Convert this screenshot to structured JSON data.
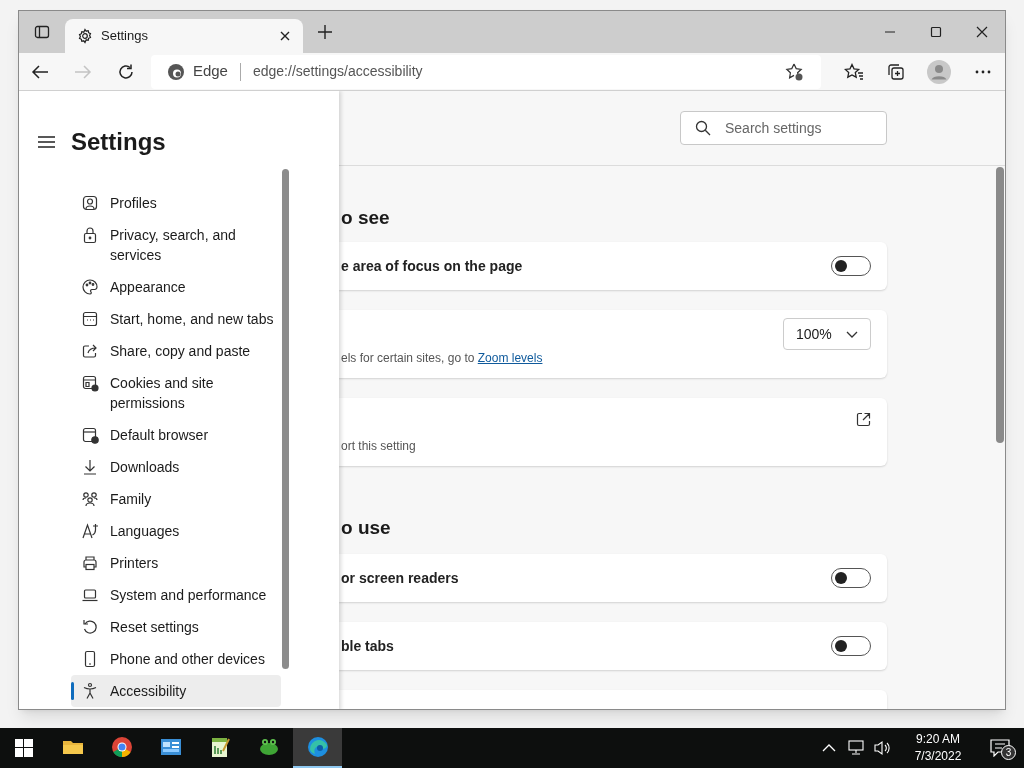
{
  "tab": {
    "title": "Settings"
  },
  "address_bar": {
    "site": "Edge",
    "url": "edge://settings/accessibility"
  },
  "sidebar": {
    "title": "Settings",
    "items": [
      {
        "label": "Profiles",
        "selected": false
      },
      {
        "label": "Privacy, search, and services",
        "selected": false
      },
      {
        "label": "Appearance",
        "selected": false
      },
      {
        "label": "Start, home, and new tabs",
        "selected": false
      },
      {
        "label": "Share, copy and paste",
        "selected": false
      },
      {
        "label": "Cookies and site permissions",
        "selected": false
      },
      {
        "label": "Default browser",
        "selected": false
      },
      {
        "label": "Downloads",
        "selected": false
      },
      {
        "label": "Family",
        "selected": false
      },
      {
        "label": "Languages",
        "selected": false
      },
      {
        "label": "Printers",
        "selected": false
      },
      {
        "label": "System and performance",
        "selected": false
      },
      {
        "label": "Reset settings",
        "selected": false
      },
      {
        "label": "Phone and other devices",
        "selected": false
      },
      {
        "label": "Accessibility",
        "selected": true
      }
    ]
  },
  "search": {
    "placeholder": "Search settings"
  },
  "sections": [
    {
      "heading": "o see",
      "cards": [
        {
          "kind": "toggle",
          "label": "e area of focus on the page",
          "on": false
        },
        {
          "kind": "dropdown",
          "description": "els for certain sites, go to ",
          "link": "Zoom levels",
          "value": "100%"
        },
        {
          "kind": "external",
          "description": "ort this setting"
        }
      ]
    },
    {
      "heading": "o use",
      "cards": [
        {
          "kind": "toggle",
          "label": "or screen readers",
          "on": false
        },
        {
          "kind": "toggle",
          "label": "ble tabs",
          "on": false
        },
        {
          "kind": "blank"
        }
      ]
    }
  ],
  "taskbar": {
    "apps": [
      {
        "selected": false
      },
      {
        "selected": false
      },
      {
        "selected": false
      },
      {
        "selected": false
      },
      {
        "selected": false
      },
      {
        "selected": true
      }
    ],
    "time": "9:20 AM",
    "date": "7/3/2022",
    "notifications": "3"
  }
}
